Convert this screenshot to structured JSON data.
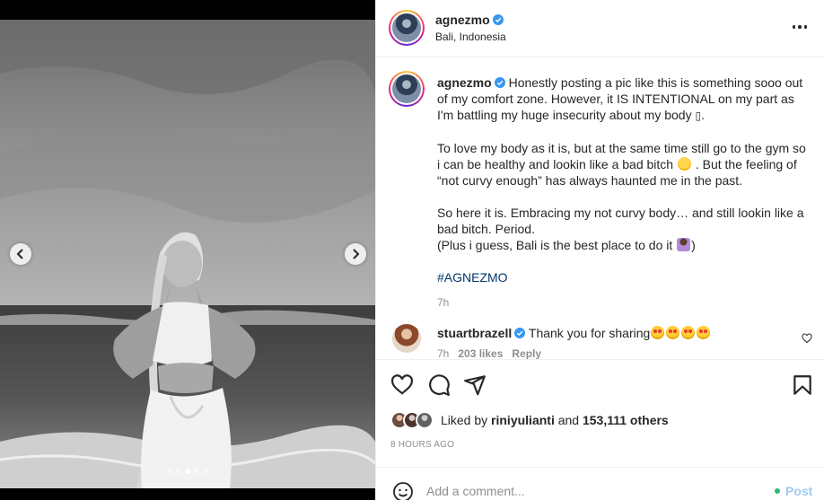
{
  "post": {
    "username": "agnezmo",
    "location": "Bali, Indonesia",
    "carousel_count": 5,
    "carousel_active_index": 2
  },
  "caption": {
    "username": "agnezmo",
    "p1": "Honestly posting a pic like this is something sooo out of my comfort zone. However, it IS INTENTIONAL on my part as I'm battling my huge insecurity about my body ",
    "p1_glyph": "▯",
    "p1_end": ".",
    "p2a": "To love my body as it is, but at the same time still go to the gym so i can be healthy and lookin like a bad bitch ",
    "p2b": " . But the feeling of “not curvy enough” has always haunted me in the past.",
    "p3a": "So here it is. Embracing my not curvy body… and still lookin like a bad bitch. Period.",
    "p3b": "(Plus i guess, Bali is the best place to do it ",
    "p3c": ")",
    "hashtag": "#AGNEZMO",
    "time": "7h"
  },
  "comment": {
    "username": "stuartbrazell",
    "text": "Thank you for sharing",
    "time": "7h",
    "likes": "203 likes",
    "reply": "Reply"
  },
  "likes": {
    "prefix": "Liked by",
    "user": "riniyulianti",
    "and": "and",
    "count": "153,111 others"
  },
  "timestamp": "8 HOURS AGO",
  "add_comment": {
    "placeholder": "Add a comment...",
    "post_label": "Post"
  },
  "icons": {
    "verified": "verified-badge-icon",
    "more": "more-options-icon",
    "like": "heart-icon",
    "comment": "comment-icon",
    "share": "share-icon",
    "save": "bookmark-icon",
    "emoji": "smiley-icon"
  },
  "colors": {
    "verified": "#3897f0",
    "hashtag": "#00376b",
    "post_button": "#9fc9f5",
    "muted": "#8e8e8e"
  }
}
